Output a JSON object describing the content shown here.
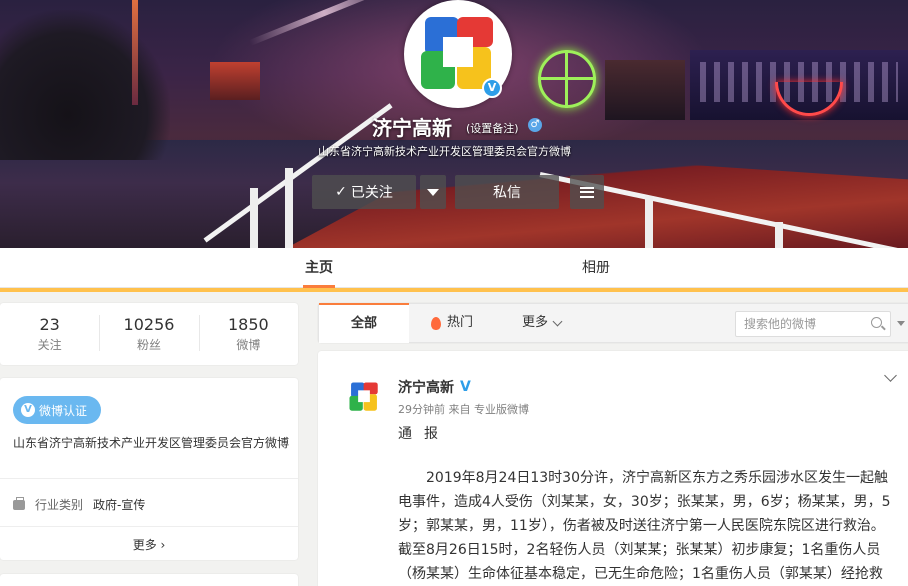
{
  "profile": {
    "name": "济宁高新",
    "remark": "(设置备注)",
    "description": "山东省济宁高新技术产业开发区管理委员会官方微博",
    "verified_mark": "V",
    "gender_mark": "♂",
    "actions": {
      "follow_label": "已关注",
      "follow_check": "✓",
      "message_label": "私信"
    }
  },
  "tabs": {
    "home": "主页",
    "album": "相册"
  },
  "stats": [
    {
      "value": "23",
      "label": "关注"
    },
    {
      "value": "10256",
      "label": "粉丝"
    },
    {
      "value": "1850",
      "label": "微博"
    }
  ],
  "verification": {
    "badge_label": "微博认证",
    "badge_mark": "V",
    "description": "山东省济宁高新技术产业开发区管理委员会官方微博",
    "industry_label": "行业类别",
    "industry_value": "政府-宣传",
    "more_label": "更多 ›"
  },
  "filter": {
    "all": "全部",
    "hot": "热门",
    "more": "更多",
    "search_placeholder": "搜索他的微博"
  },
  "post": {
    "author": "济宁高新",
    "verified_mark": "V",
    "meta": "29分钟前 来自 专业版微博",
    "heading": "通报",
    "body": "2019年8月24日13时30分许，济宁高新区东方之秀乐园涉水区发生一起触电事件，造成4人受伤（刘某某，女，30岁；张某某，男，6岁；杨某某，男，5岁；郭某某，男，11岁），伤者被及时送往济宁第一人民医院东院区进行救治。截至8月26日15时，2名轻伤人员（刘某某；张某某）初步康复；1名重伤人员（杨某某）生命体征基本稳定，已无生命危险；1名重伤人员（郭某某）经抢救无"
  },
  "colors": {
    "accent": "#fa7d3c",
    "strip": "#ffc14d",
    "verify_blue": "#6ab8f0",
    "logo": [
      "#e53935",
      "#2b6fd6",
      "#2fb24a",
      "#f6c21c"
    ]
  }
}
